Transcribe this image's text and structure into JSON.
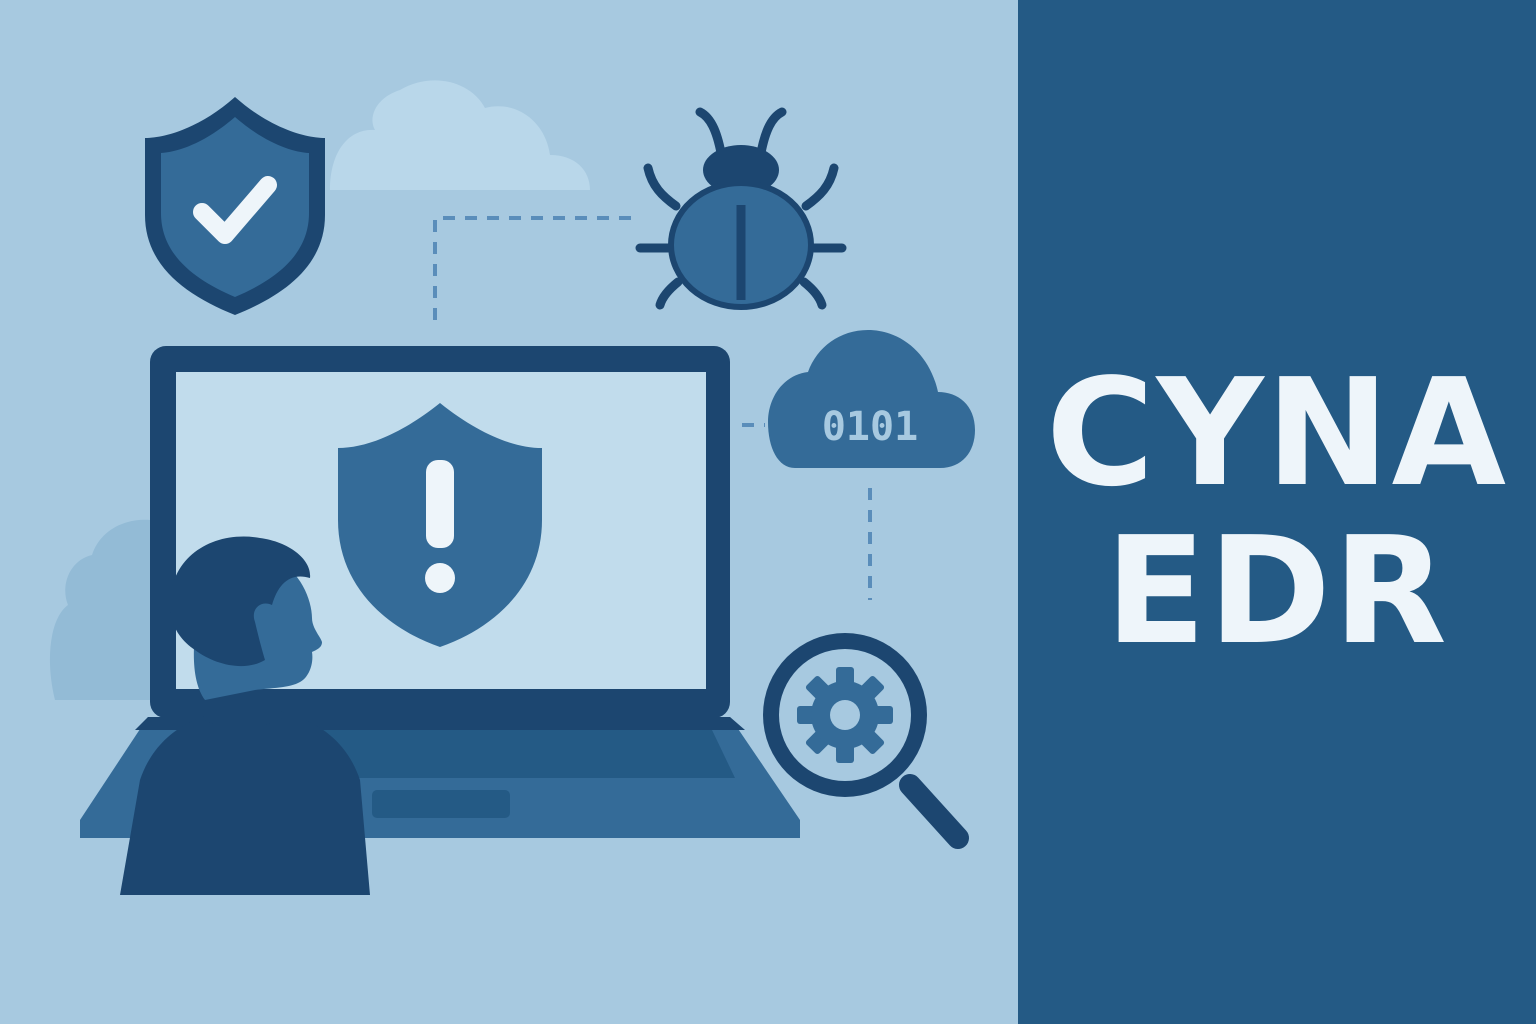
{
  "title": {
    "line1": "CYNA",
    "line2": "EDR"
  },
  "cloud_badge": {
    "text": "0101"
  },
  "icons": [
    "shield-check-icon",
    "bug-icon",
    "cloud-binary-icon",
    "laptop-icon",
    "shield-alert-icon",
    "magnifier-gear-icon",
    "person-icon"
  ],
  "colors": {
    "background_light": "#a7c9e0",
    "panel_dark": "#245a85",
    "icon_mid": "#346b98",
    "icon_dark": "#1c4670",
    "screen": "#c1dcec",
    "title_text": "#eef5fa"
  }
}
